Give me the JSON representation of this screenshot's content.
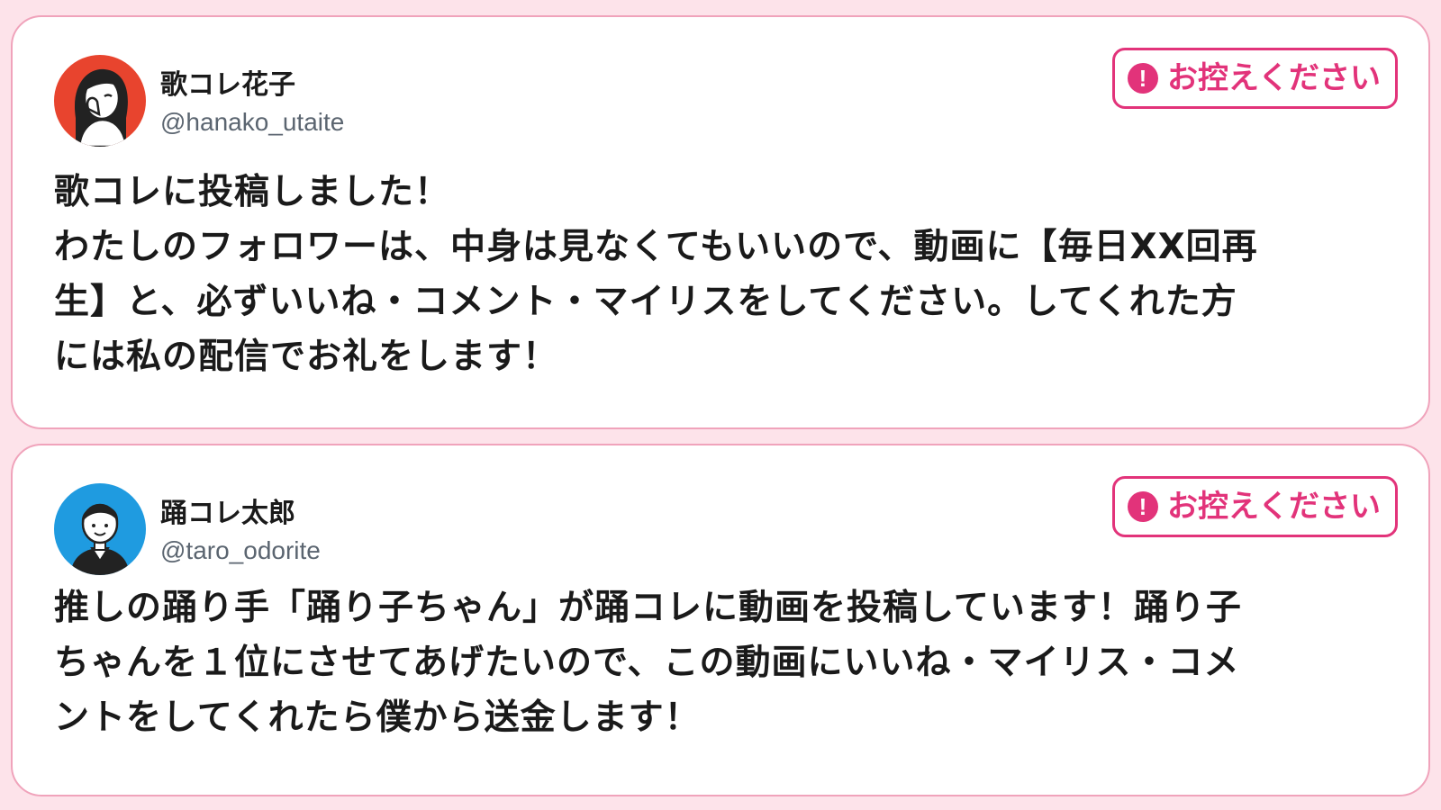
{
  "posts": [
    {
      "author": {
        "name": "歌コレ花子",
        "handle": "@hanako_utaite",
        "avatar_icon": "woman-avatar-icon",
        "avatar_bg": "#e8442e"
      },
      "badge": {
        "icon": "exclamation-icon",
        "label": "お控えください",
        "color": "#e2337a"
      },
      "body_lines": [
        "歌コレに投稿しました！",
        "わたしのフォロワーは、中身は見なくてもいいので、動画に【毎日XX回再",
        "生】と、必ずいいね・コメント・マイリスをしてください。してくれた方",
        "には私の配信でお礼をします！"
      ]
    },
    {
      "author": {
        "name": "踊コレ太郎",
        "handle": "@taro_odorite",
        "avatar_icon": "man-avatar-icon",
        "avatar_bg": "#1f9be0"
      },
      "badge": {
        "icon": "exclamation-icon",
        "label": "お控えください",
        "color": "#e2337a"
      },
      "body_lines": [
        "推しの踊り手「踊り子ちゃん」が踊コレに動画を投稿しています！踊り子",
        "ちゃんを１位にさせてあげたいので、この動画にいいね・マイリス・コメ",
        "ントをしてくれたら僕から送金します！"
      ]
    }
  ],
  "page_bg": "#fde3ea",
  "card_border": "#f0a3bb"
}
